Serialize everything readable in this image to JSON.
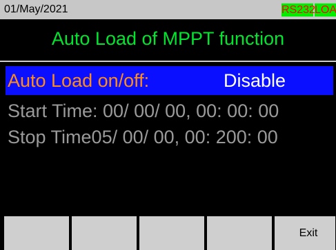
{
  "status_bar": {
    "date": "01/May/2021",
    "badges": [
      "RS232",
      "LOAD"
    ]
  },
  "screen": {
    "title": "Auto Load of MPPT function"
  },
  "settings": {
    "auto_load": {
      "label": "Auto Load on/off:",
      "value": "Disable"
    },
    "start_time": "Start Time: 00/ 00/ 00, 00: 00: 00",
    "stop_time": "Stop Time05/ 00/ 00, 00: 200: 00"
  },
  "softkeys": [
    "",
    "",
    "",
    "",
    "Exit"
  ],
  "colors": {
    "title_green": "#00e62e",
    "selection_blue": "#0a10ff",
    "label_orange": "#ff8c1a",
    "badge_green": "#00ee00",
    "badge_text_red": "#ff0000"
  }
}
